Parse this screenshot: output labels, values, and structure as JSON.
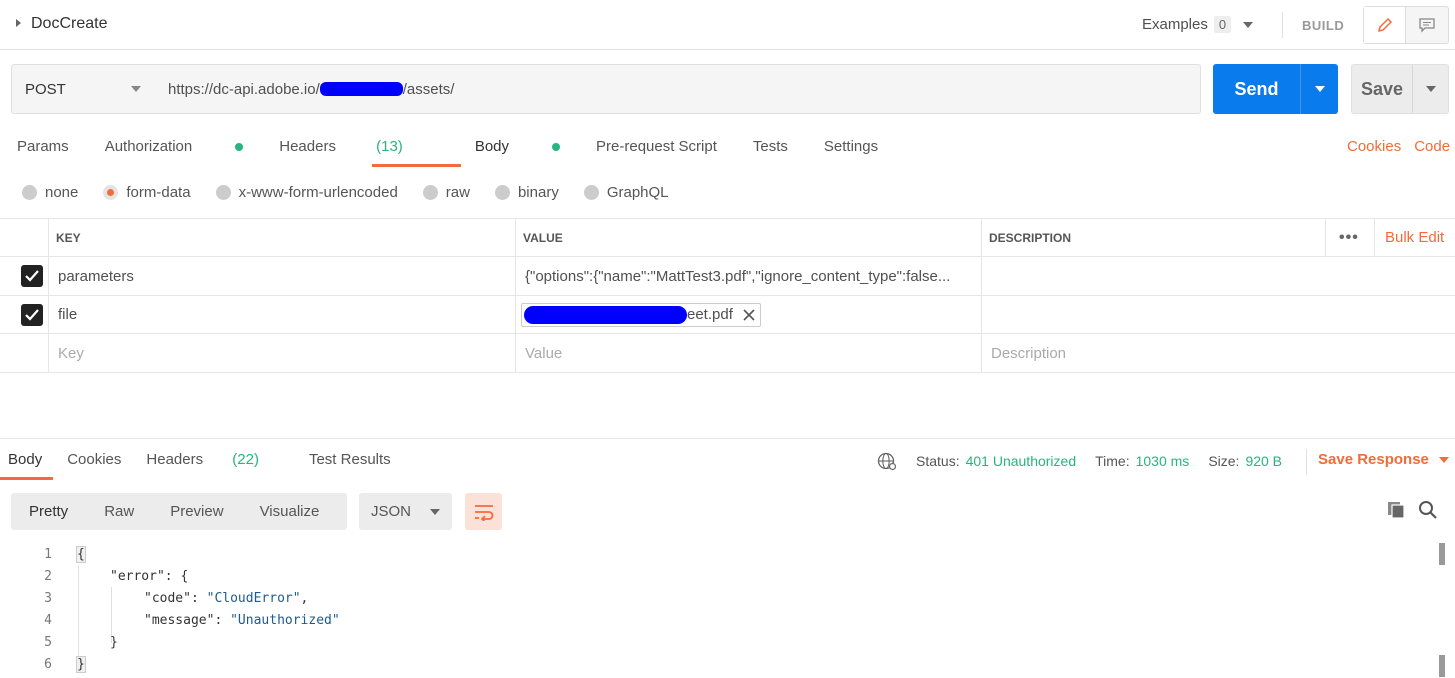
{
  "header": {
    "request_name": "DocCreate",
    "examples_label": "Examples",
    "examples_count": "0",
    "build_label": "BUILD"
  },
  "request": {
    "method": "POST",
    "url_prefix": "https://dc-api.adobe.io/",
    "url_suffix": "/assets/",
    "send_label": "Send",
    "save_label": "Save"
  },
  "request_tabs": {
    "params": "Params",
    "authorization": "Authorization",
    "headers": "Headers",
    "headers_count": "(13)",
    "body": "Body",
    "prerequest": "Pre-request Script",
    "tests": "Tests",
    "settings": "Settings",
    "cookies": "Cookies",
    "code": "Code"
  },
  "body_types": {
    "none": "none",
    "form_data": "form-data",
    "urlencoded": "x-www-form-urlencoded",
    "raw": "raw",
    "binary": "binary",
    "graphql": "GraphQL",
    "selected": "form-data"
  },
  "table": {
    "headers": {
      "key": "KEY",
      "value": "VALUE",
      "description": "DESCRIPTION"
    },
    "bulk_edit": "Bulk Edit",
    "rows": [
      {
        "key": "parameters",
        "value": "{\"options\":{\"name\":\"MattTest3.pdf\",\"ignore_content_type\":false...",
        "checked": true
      },
      {
        "key": "file",
        "value_visible_suffix": "eet.pdf",
        "checked": true
      }
    ],
    "placeholders": {
      "key": "Key",
      "value": "Value",
      "description": "Description"
    }
  },
  "response": {
    "tabs": {
      "body": "Body",
      "cookies": "Cookies",
      "headers": "Headers",
      "headers_count": "(22)",
      "test_results": "Test Results"
    },
    "status_label": "Status:",
    "status_value": "401 Unauthorized",
    "time_label": "Time:",
    "time_value": "1030 ms",
    "size_label": "Size:",
    "size_value": "920 B",
    "save_response": "Save Response",
    "views": {
      "pretty": "Pretty",
      "raw": "Raw",
      "preview": "Preview",
      "visualize": "Visualize"
    },
    "format": "JSON"
  },
  "code_lines": {
    "n1": "1",
    "n2": "2",
    "n3": "3",
    "n4": "4",
    "n5": "5",
    "n6": "6",
    "l1": "{",
    "l2_key": "\"error\"",
    "l2_rest": ": {",
    "l3_key": "\"code\"",
    "l3_val": "\"CloudError\"",
    "l4_key": "\"message\"",
    "l4_val": "\"Unauthorized\"",
    "l5": "}",
    "l6": "}"
  },
  "colors": {
    "accent": "#f26b3a",
    "send_blue": "#097bed",
    "success_green": "#26b47f",
    "redaction": "#0000ff"
  }
}
